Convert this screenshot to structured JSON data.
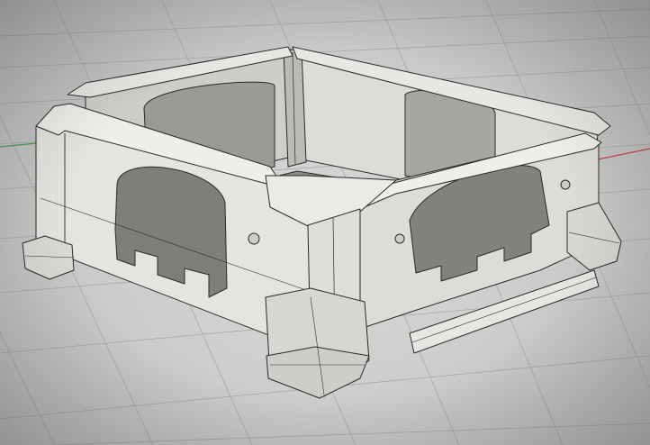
{
  "viewport": {
    "label": "",
    "background_color": "#cfcfcf",
    "grid_color": "#aaaaaa",
    "x_axis_color": "#c24a4a",
    "y_axis_color": "#3fa04a",
    "model_face_color": "#e4e2de",
    "model_edge_color": "#2a2a2a",
    "display_mode": "shaded-with-edges",
    "object": "3d-printed-frame-model"
  }
}
